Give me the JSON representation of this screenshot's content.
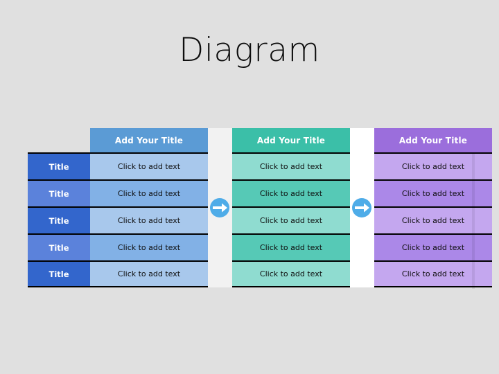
{
  "page": {
    "title": "Diagram",
    "background_color": "#e0e0e0"
  },
  "diagram": {
    "row_label_header": "",
    "row_labels": [
      "Title",
      "Title",
      "Title",
      "Title",
      "Title"
    ],
    "row_label_colors": [
      "#3366cc",
      "#5b82db",
      "#3366cc",
      "#5b82db",
      "#3366cc"
    ],
    "columns": [
      {
        "header": "Add Your Title",
        "header_color": "#5b9bd5",
        "cell_colors": [
          "#a8c8ec",
          "#82b1e6",
          "#a8c8ec",
          "#82b1e6",
          "#a8c8ec"
        ],
        "cells": [
          "Click to add text",
          "Click to add text",
          "Click to add text",
          "Click to add text",
          "Click to add text"
        ]
      },
      {
        "header": "Add Your Title",
        "header_color": "#3bbfa8",
        "cell_colors": [
          "#8fdcd0",
          "#56c9b6",
          "#8fdcd0",
          "#56c9b6",
          "#8fdcd0"
        ],
        "cells": [
          "Click to add text",
          "Click to add text",
          "Click to add text",
          "Click to add text",
          "Click to add text"
        ]
      },
      {
        "header": "Add Your Title",
        "header_color": "#9b6edc",
        "cell_colors": [
          "#c4a7ef",
          "#ab88e8",
          "#c4a7ef",
          "#ab88e8",
          "#c4a7ef"
        ],
        "cells": [
          "Click to add text",
          "Click to add text",
          "Click to add text",
          "Click to add text",
          "Click to add text"
        ]
      }
    ],
    "connectors": [
      {
        "icon": "arrow-right-circle-icon",
        "circle_color": "#4facE8",
        "arrow_color": "#ffffff"
      },
      {
        "icon": "arrow-right-circle-icon",
        "circle_color": "#4facE8",
        "arrow_color": "#ffffff"
      }
    ],
    "divider_color": "#000000"
  }
}
